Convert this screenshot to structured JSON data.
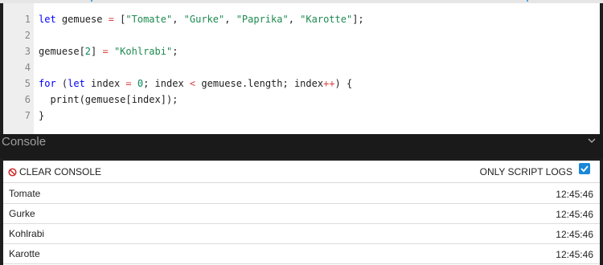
{
  "editor": {
    "lines": [
      {
        "n": "1",
        "tokens": [
          {
            "t": "let",
            "c": "kw"
          },
          {
            "t": " gemuese ",
            "c": ""
          },
          {
            "t": "=",
            "c": "op"
          },
          {
            "t": " [",
            "c": ""
          },
          {
            "t": "\"Tomate\"",
            "c": "str"
          },
          {
            "t": ", ",
            "c": ""
          },
          {
            "t": "\"Gurke\"",
            "c": "str"
          },
          {
            "t": ", ",
            "c": ""
          },
          {
            "t": "\"Paprika\"",
            "c": "str"
          },
          {
            "t": ", ",
            "c": ""
          },
          {
            "t": "\"Karotte\"",
            "c": "str"
          },
          {
            "t": "];",
            "c": ""
          }
        ]
      },
      {
        "n": "2",
        "tokens": []
      },
      {
        "n": "3",
        "tokens": [
          {
            "t": "gemuese[",
            "c": ""
          },
          {
            "t": "2",
            "c": "num"
          },
          {
            "t": "] ",
            "c": ""
          },
          {
            "t": "=",
            "c": "op"
          },
          {
            "t": " ",
            "c": ""
          },
          {
            "t": "\"Kohlrabi\"",
            "c": "str"
          },
          {
            "t": ";",
            "c": ""
          }
        ]
      },
      {
        "n": "4",
        "tokens": []
      },
      {
        "n": "5",
        "tokens": [
          {
            "t": "for",
            "c": "kw"
          },
          {
            "t": " (",
            "c": ""
          },
          {
            "t": "let",
            "c": "kw"
          },
          {
            "t": " index ",
            "c": ""
          },
          {
            "t": "=",
            "c": "op"
          },
          {
            "t": " ",
            "c": ""
          },
          {
            "t": "0",
            "c": "num"
          },
          {
            "t": "; index ",
            "c": ""
          },
          {
            "t": "<",
            "c": "op"
          },
          {
            "t": " gemuese.length; index",
            "c": ""
          },
          {
            "t": "++",
            "c": "op"
          },
          {
            "t": ") {",
            "c": ""
          }
        ]
      },
      {
        "n": "6",
        "tokens": [
          {
            "t": "  print(gemuese[index]);",
            "c": ""
          }
        ]
      },
      {
        "n": "7",
        "tokens": [
          {
            "t": "}",
            "c": ""
          }
        ]
      }
    ]
  },
  "console": {
    "title": "Console",
    "chevron_icon": "chevron-down-icon",
    "clear_label": "CLEAR CONSOLE",
    "clear_icon": "no-entry-icon",
    "script_logs_label": "ONLY SCRIPT LOGS",
    "script_logs_checked": true,
    "accent_color": "#1a87d8",
    "logs": [
      {
        "text": "Tomate",
        "time": "12:45:46"
      },
      {
        "text": "Gurke",
        "time": "12:45:46"
      },
      {
        "text": "Kohlrabi",
        "time": "12:45:46"
      },
      {
        "text": "Karotte",
        "time": "12:45:46"
      }
    ]
  }
}
